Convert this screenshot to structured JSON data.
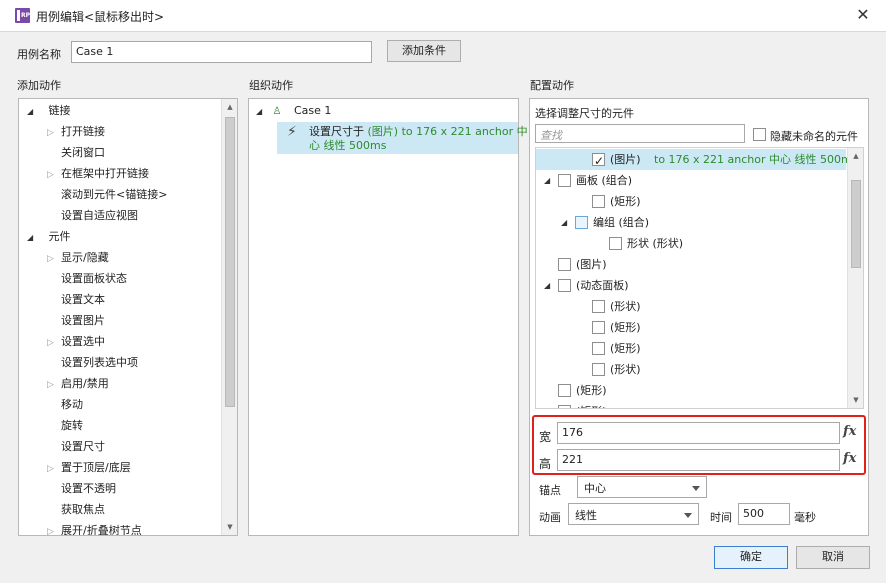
{
  "window": {
    "title": "用例编辑<鼠标移出时>"
  },
  "case_name": {
    "label": "用例名称",
    "value": "Case 1",
    "add_condition": "添加条件"
  },
  "sections": {
    "add_action": "添加动作",
    "organize_action": "组织动作",
    "configure_action": "配置动作"
  },
  "add_action_tree": {
    "link": "链接",
    "link_items": [
      "打开链接",
      "关闭窗口",
      "在框架中打开链接",
      "滚动到元件<锚链接>",
      "设置自适应视图"
    ],
    "widget": "元件",
    "widget_items": [
      "显示/隐藏",
      "设置面板状态",
      "设置文本",
      "设置图片",
      "设置选中",
      "设置列表选中项",
      "启用/禁用",
      "移动",
      "旋转",
      "设置尺寸",
      "置于顶层/底层",
      "设置不透明",
      "获取焦点",
      "展开/折叠树节点"
    ]
  },
  "organize": {
    "case": "Case 1",
    "action_prefix": "设置尺寸于",
    "action_detail_line1": "(图片) to 176 x 221 anchor 中",
    "action_detail_line2": "心 线性 500ms"
  },
  "configure": {
    "select_label": "选择调整尺寸的元件",
    "search_placeholder": "查找",
    "hide_unnamed": "隐藏未命名的元件",
    "tree": [
      {
        "label": "(图片)",
        "extra": "to 176 x 221 anchor 中心 线性 500ms",
        "checked": true
      },
      {
        "label": "画板 (组合)"
      },
      {
        "label": "(矩形)"
      },
      {
        "label": "编组 (组合)"
      },
      {
        "label": "形状 (形状)"
      },
      {
        "label": "(图片)"
      },
      {
        "label": "(动态面板)"
      },
      {
        "label": "(形状)"
      },
      {
        "label": "(矩形)"
      },
      {
        "label": "(矩形)"
      },
      {
        "label": "(形状)"
      },
      {
        "label": "(矩形)"
      },
      {
        "label": "(矩形)"
      }
    ],
    "width_label": "宽",
    "width_value": "176",
    "height_label": "高",
    "height_value": "221",
    "fx": "fx",
    "anchor_label": "锚点",
    "anchor_value": "中心",
    "animation_label": "动画",
    "animation_value": "线性",
    "time_label": "时间",
    "time_value": "500",
    "ms_label": "毫秒"
  },
  "footer": {
    "ok": "确定",
    "cancel": "取消"
  },
  "colors": {
    "accent_red": "#e0201b",
    "green_text": "#2e8b2e",
    "selection": "#cce8f4"
  }
}
